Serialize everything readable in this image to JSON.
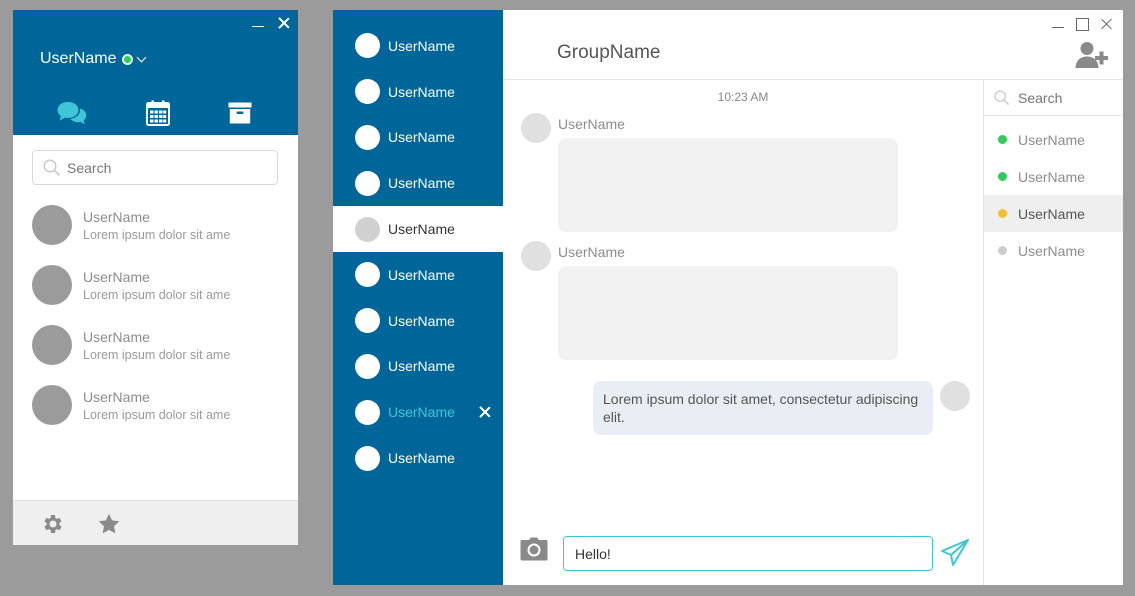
{
  "contacts_window": {
    "user": {
      "name": "UserName",
      "status_color": "#2ecc5b"
    },
    "tabs": [
      {
        "icon": "chat-bubbles-icon",
        "color": "#3ec6d6"
      },
      {
        "icon": "calendar-icon",
        "color": "#ffffff"
      },
      {
        "icon": "archive-icon",
        "color": "#ffffff"
      }
    ],
    "search": {
      "placeholder": "Search",
      "value": ""
    },
    "conversations": [
      {
        "name": "UserName",
        "preview": "Lorem ipsum dolor sit ame"
      },
      {
        "name": "UserName",
        "preview": "Lorem ipsum dolor sit ame"
      },
      {
        "name": "UserName",
        "preview": "Lorem ipsum dolor sit ame"
      },
      {
        "name": "UserName",
        "preview": "Lorem ipsum dolor sit ame"
      }
    ],
    "footer": {
      "icons": [
        "gear-icon",
        "star-icon"
      ]
    }
  },
  "chat_window": {
    "sidebar": {
      "items": [
        {
          "name": "UserName"
        },
        {
          "name": "UserName"
        },
        {
          "name": "UserName"
        },
        {
          "name": "UserName"
        },
        {
          "name": "UserName",
          "state": "active"
        },
        {
          "name": "UserName"
        },
        {
          "name": "UserName"
        },
        {
          "name": "UserName"
        },
        {
          "name": "UserName",
          "state": "highlight"
        },
        {
          "name": "UserName"
        }
      ]
    },
    "header": {
      "group_name": "GroupName"
    },
    "messages": {
      "timestamp": "10:23 AM",
      "items": [
        {
          "user": "UserName",
          "direction": "in"
        },
        {
          "user": "UserName",
          "direction": "in"
        },
        {
          "direction": "out",
          "text": "Lorem ipsum dolor sit amet, consectetur adipiscing elit."
        }
      ]
    },
    "composer": {
      "value": "Hello!",
      "placeholder": ""
    },
    "members": {
      "search": {
        "placeholder": "Search"
      },
      "items": [
        {
          "name": "UserName",
          "status_color": "#2ecc5b"
        },
        {
          "name": "UserName",
          "status_color": "#2ecc5b"
        },
        {
          "name": "UserName",
          "status_color": "#f5c02f",
          "highlight": true
        },
        {
          "name": "UserName",
          "status_color": "#cccccc"
        }
      ]
    },
    "colors": {
      "primary": "#006699",
      "accent": "#3ec6d6"
    }
  }
}
